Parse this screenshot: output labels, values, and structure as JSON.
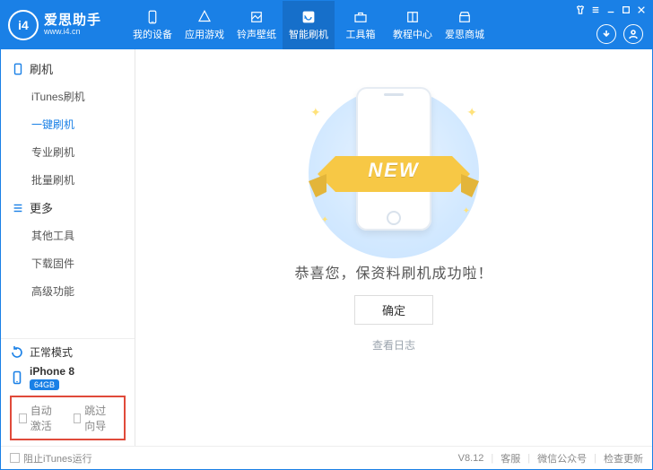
{
  "brand": {
    "logo_text": "i4",
    "title": "爱思助手",
    "subtitle": "www.i4.cn"
  },
  "nav": {
    "items": [
      {
        "label": "我的设备"
      },
      {
        "label": "应用游戏"
      },
      {
        "label": "铃声壁纸"
      },
      {
        "label": "智能刷机"
      },
      {
        "label": "工具箱"
      },
      {
        "label": "教程中心"
      },
      {
        "label": "爱思商城"
      }
    ],
    "active_index": 3
  },
  "sidebar": {
    "sections": [
      {
        "title": "刷机",
        "items": [
          "iTunes刷机",
          "一键刷机",
          "专业刷机",
          "批量刷机"
        ],
        "active_index": 1
      },
      {
        "title": "更多",
        "items": [
          "其他工具",
          "下载固件",
          "高级功能"
        ],
        "active_index": -1
      }
    ],
    "mode_label": "正常模式",
    "device_name": "iPhone 8",
    "device_badge": "64GB",
    "check_auto_activate": "自动激活",
    "check_skip_guide": "跳过向导"
  },
  "main": {
    "ribbon_text": "NEW",
    "success_text": "恭喜您，保资料刷机成功啦！",
    "ok_button": "确定",
    "view_log": "查看日志"
  },
  "footer": {
    "block_itunes": "阻止iTunes运行",
    "version": "V8.12",
    "support": "客服",
    "wechat": "微信公众号",
    "check_update": "检查更新"
  },
  "colors": {
    "primary": "#1a80e6",
    "accent_red": "#e04a3a",
    "ribbon": "#f7c845"
  }
}
